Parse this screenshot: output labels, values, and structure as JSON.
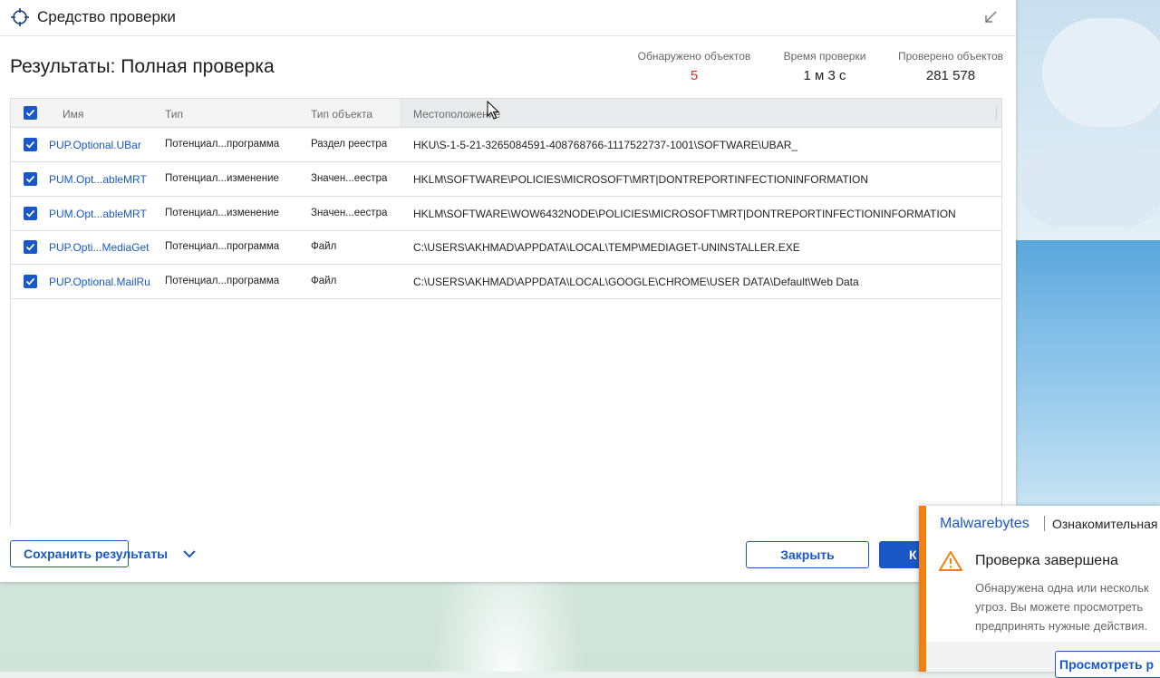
{
  "window": {
    "title": "Средство проверки",
    "results_title": "Результаты: Полная проверка"
  },
  "stats": {
    "detected_label": "Обнаружено объектов",
    "detected_value": "5",
    "time_label": "Время проверки",
    "time_value": "1 м 3 с",
    "checked_label": "Проверено объектов",
    "checked_value": "281 578"
  },
  "table": {
    "columns": [
      "Имя",
      "Тип",
      "Тип объекта",
      "Местоположение"
    ],
    "rows": [
      {
        "name": "PUP.Optional.UBar",
        "type": "Потенциал...программа",
        "object_type": "Раздел реестра",
        "location": "HKU\\S-1-5-21-3265084591-408768766-1117522737-1001\\SOFTWARE\\UBAR_",
        "checked": true
      },
      {
        "name": "PUM.Opt...ableMRT",
        "type": "Потенциал...изменение",
        "object_type": "Значен...еестра",
        "location": "HKLM\\SOFTWARE\\POLICIES\\MICROSOFT\\MRT|DONTREPORTINFECTIONINFORMATION",
        "checked": true
      },
      {
        "name": "PUM.Opt...ableMRT",
        "type": "Потенциал...изменение",
        "object_type": "Значен...еестра",
        "location": "HKLM\\SOFTWARE\\WOW6432NODE\\POLICIES\\MICROSOFT\\MRT|DONTREPORTINFECTIONINFORMATION",
        "checked": true
      },
      {
        "name": "PUP.Opti...MediaGet",
        "type": "Потенциал...программа",
        "object_type": "Файл",
        "location": "C:\\USERS\\AKHMAD\\APPDATA\\LOCAL\\TEMP\\MEDIAGET-UNINSTALLER.EXE",
        "checked": true
      },
      {
        "name": "PUP.Optional.MailRu",
        "type": "Потенциал...программа",
        "object_type": "Файл",
        "location": "C:\\USERS\\AKHMAD\\APPDATA\\LOCAL\\GOOGLE\\CHROME\\USER DATA\\Default\\Web Data",
        "checked": true
      }
    ]
  },
  "buttons": {
    "save": "Сохранить результаты",
    "close": "Закрыть",
    "primary": "К"
  },
  "notification": {
    "brand": "Malwarebytes",
    "edition": "Ознакомительная",
    "heading": "Проверка завершена",
    "body_lines": [
      "Обнаружена одна или нескольк",
      "угроз. Вы можете просмотреть",
      "предпринять нужные действия."
    ],
    "button": "Просмотреть р"
  },
  "colors": {
    "accent": "#1a58c7",
    "danger": "#d32f2f",
    "toast_accent": "#f07f14"
  }
}
